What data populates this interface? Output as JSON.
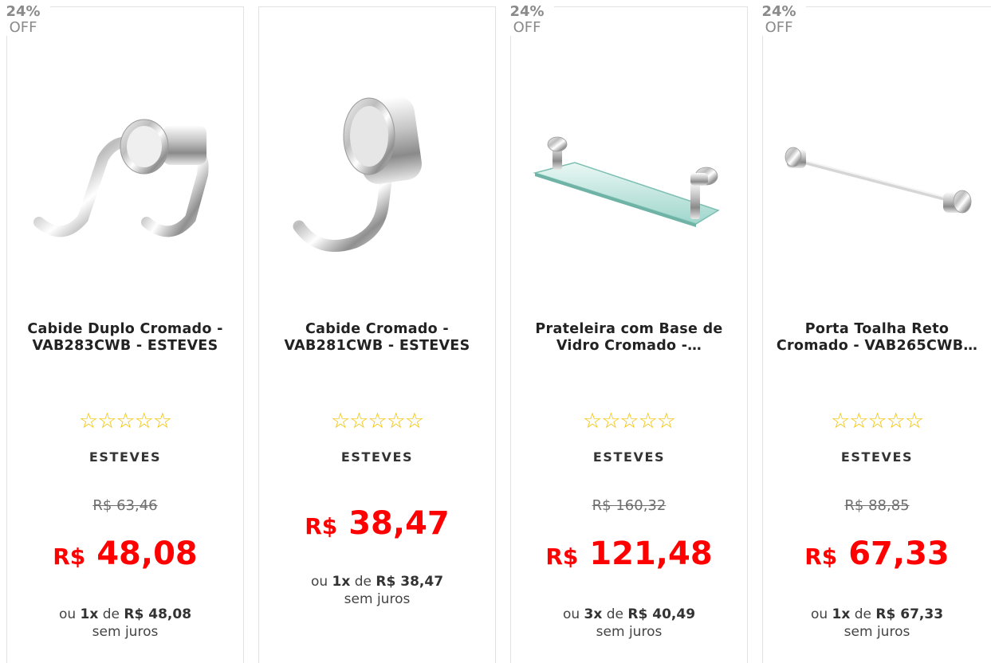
{
  "colors": {
    "price": "#ff0000",
    "star": "#f2c200",
    "text": "#222222",
    "border": "#e2e2e2"
  },
  "installment_parts": {
    "prefix": "ou",
    "times_suffix": "x",
    "de": "de",
    "currency": "R$"
  },
  "products": [
    {
      "discount_pct": "24%",
      "discount_off": "OFF",
      "image_icon": "double-chrome-hook-icon",
      "title": "Cabide Duplo Cromado -\nVAB283CWB - ESTEVES",
      "stars": "☆☆☆☆☆",
      "brand": "ESTEVES",
      "old_price": "R$ 63,46",
      "price_currency": "R$",
      "price_value": "48,08",
      "installments": "1",
      "installment_value": "R$ 48,08",
      "no_interest": "sem juros"
    },
    {
      "discount_pct": "",
      "discount_off": "",
      "image_icon": "single-chrome-hook-icon",
      "title": "Cabide Cromado -\nVAB281CWB - ESTEVES",
      "stars": "☆☆☆☆☆",
      "brand": "ESTEVES",
      "old_price": "",
      "price_currency": "R$",
      "price_value": "38,47",
      "installments": "1",
      "installment_value": "R$ 38,47",
      "no_interest": "sem juros"
    },
    {
      "discount_pct": "24%",
      "discount_off": "OFF",
      "image_icon": "glass-shelf-icon",
      "title": "Prateleira com Base de\nVidro Cromado -…",
      "stars": "☆☆☆☆☆",
      "brand": "ESTEVES",
      "old_price": "R$ 160,32",
      "price_currency": "R$",
      "price_value": "121,48",
      "installments": "3",
      "installment_value": "R$ 40,49",
      "no_interest": "sem juros"
    },
    {
      "discount_pct": "24%",
      "discount_off": "OFF",
      "image_icon": "towel-bar-icon",
      "title": "Porta Toalha Reto\nCromado - VAB265CWB…",
      "stars": "☆☆☆☆☆",
      "brand": "ESTEVES",
      "old_price": "R$ 88,85",
      "price_currency": "R$",
      "price_value": "67,33",
      "installments": "1",
      "installment_value": "R$ 67,33",
      "no_interest": "sem juros"
    }
  ]
}
